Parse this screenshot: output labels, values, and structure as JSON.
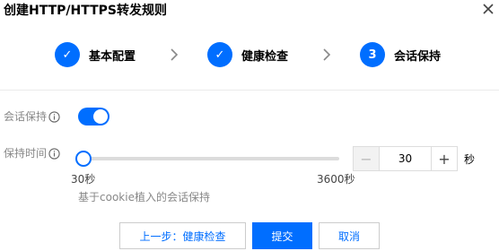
{
  "dialog": {
    "title": "创建HTTP/HTTPS转发规则",
    "close_icon": "close-icon"
  },
  "steps": [
    {
      "label": "基本配置",
      "status": "done",
      "marker": "✓"
    },
    {
      "label": "健康检查",
      "status": "done",
      "marker": "✓"
    },
    {
      "label": "会话保持",
      "status": "current",
      "marker": "3"
    }
  ],
  "colors": {
    "accent": "#006eff",
    "muted_text": "#888888",
    "border": "#dddddd"
  },
  "session_persistence": {
    "label": "会话保持",
    "info_icon": "info-icon",
    "enabled": true
  },
  "hold_time": {
    "label": "保持时间",
    "info_icon": "info-icon",
    "min_label": "30秒",
    "max_label": "3600秒",
    "min": 30,
    "max": 3600,
    "value": 30,
    "input_value": "30",
    "minus_label": "−",
    "plus_label": "+",
    "unit": "秒",
    "help": "基于cookie植入的会话保持"
  },
  "buttons": {
    "prev": "上一步：健康检查",
    "submit": "提交",
    "cancel": "取消"
  }
}
